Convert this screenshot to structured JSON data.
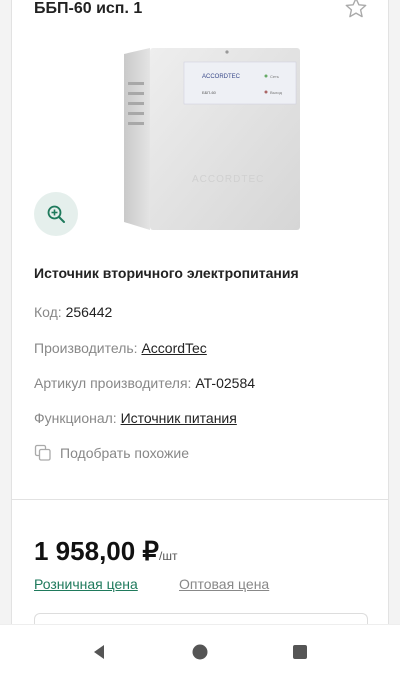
{
  "product": {
    "title": "ББП-60 исп. 1",
    "subtitle": "Источник вторичного электропитания",
    "code_label": "Код:",
    "code_value": "256442",
    "manufacturer_label": "Производитель:",
    "manufacturer_value": "AccordTec",
    "article_label": "Артикул производителя:",
    "article_value": "AT-02584",
    "function_label": "Функционал:",
    "function_value": "Источник питания",
    "similar_label": "Подобрать похожие"
  },
  "pricing": {
    "price": "1 958,00 ₽",
    "unit": "/шт",
    "tab_retail": "Розничная цена",
    "tab_wholesale": "Оптовая цена"
  },
  "device_label": {
    "brand": "ACCORDTEC",
    "model": "ББП-60",
    "line1": "Сеть",
    "line2": "Выход"
  },
  "colors": {
    "accent": "#1f7a5c",
    "zoom_bg": "#e5efec"
  },
  "icons": [
    "star-icon",
    "zoom-in-icon",
    "copy-icon",
    "back-icon",
    "home-icon",
    "recents-icon"
  ]
}
